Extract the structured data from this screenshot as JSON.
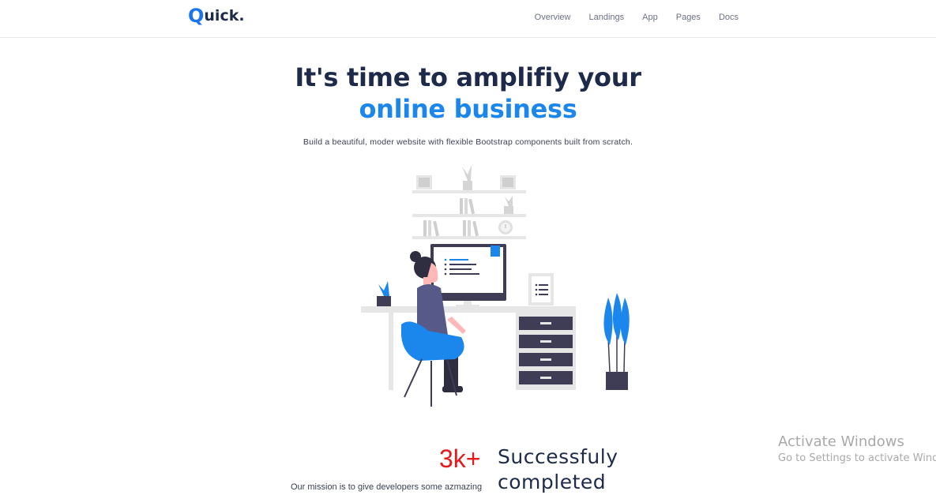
{
  "navbar": {
    "logo": {
      "mark": "Q",
      "text": "uick."
    },
    "links": [
      "Overview",
      "Landings",
      "App",
      "Pages",
      "Docs"
    ]
  },
  "hero": {
    "title_line1": "It's time to amplifiy your",
    "title_line2": "online business",
    "subtitle": "Build a beautiful, moder website with flexible Bootstrap components built from scratch.",
    "illustration_icon": "person-at-desk-illustration"
  },
  "stats": {
    "number": "3k+",
    "label_line1": "Successfuly",
    "label_line2": "completed"
  },
  "mission": {
    "text": "Our mission is to give developers some azmazing"
  },
  "os_watermark": {
    "title": "Activate Windows",
    "subtitle": "Go to Settings to activate Windows."
  },
  "colors": {
    "brand_blue": "#1b75ec",
    "accent_blue": "#1b86ec",
    "heading_navy": "#1e2a4a",
    "stat_red": "#e21b1b",
    "illustration_grey": "#e6e6e6",
    "illustration_dark": "#3f3d56"
  }
}
